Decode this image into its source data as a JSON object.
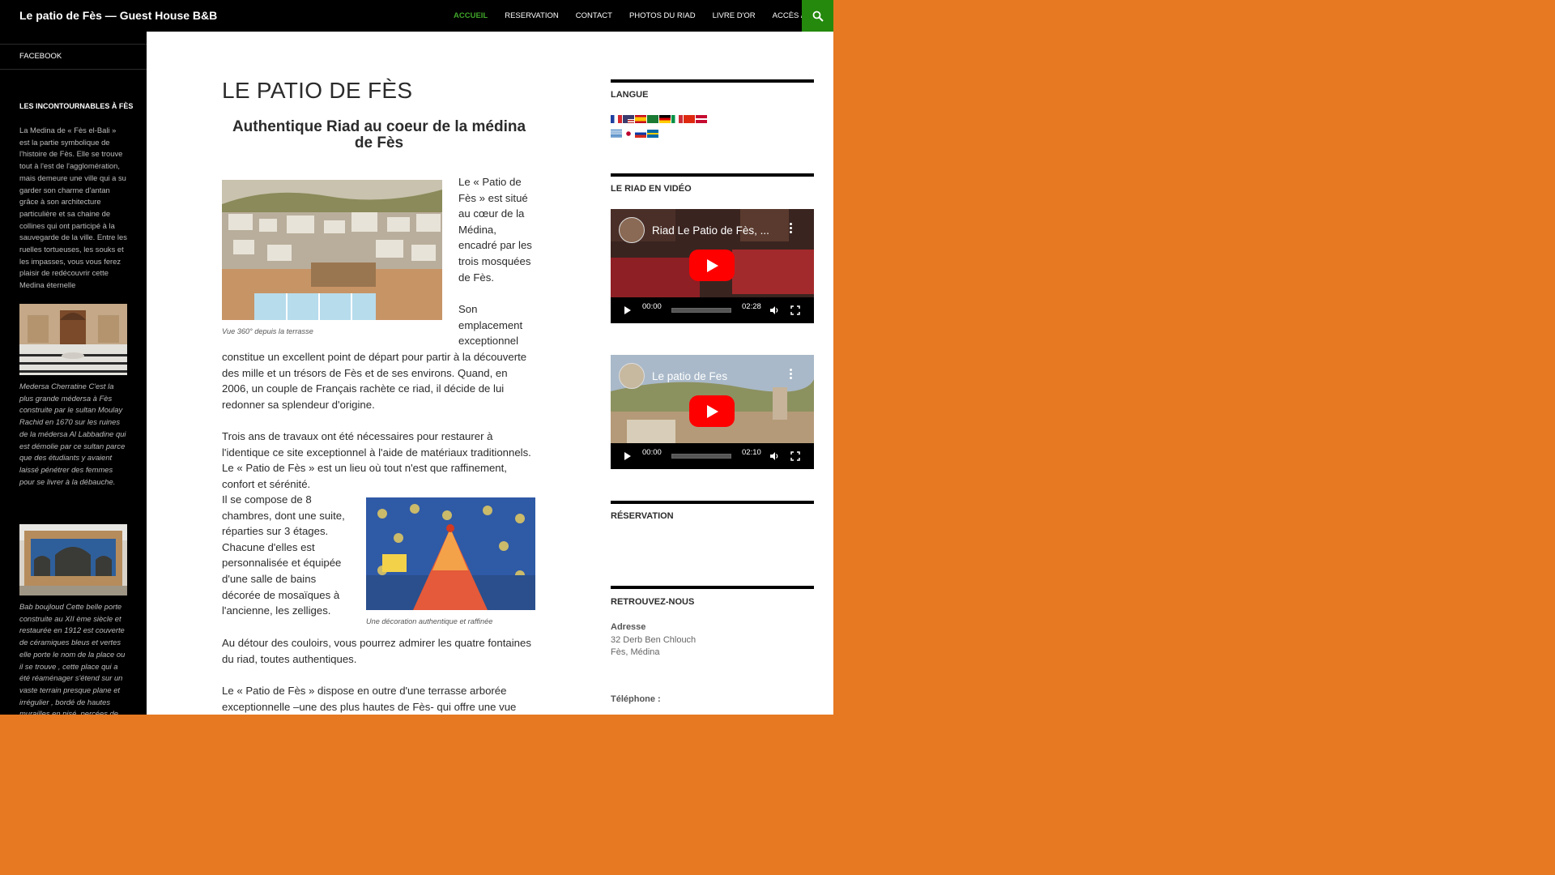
{
  "header": {
    "site_title": "Le patio de Fès — Guest House B&B",
    "nav": [
      {
        "label": "ACCUEIL",
        "active": true
      },
      {
        "label": "RESERVATION"
      },
      {
        "label": "CONTACT"
      },
      {
        "label": "PHOTOS DU RIAD"
      },
      {
        "label": "LIVRE D'OR"
      },
      {
        "label": "ACCÈS / PLAN"
      }
    ],
    "search_icon": "search-icon"
  },
  "left_sidebar": {
    "menu_item": "FACEBOOK",
    "widget_title": "LES INCONTOURNABLES À FÈS",
    "intro": "La Medina de « Fès el-Bali » est la partie symbolique de l'histoire de Fès. Elle se trouve tout à l'est de l'agglomération, mais demeure une ville qui a su garder son charme d'antan grâce à son architecture particulière et sa chaine de collines qui ont participé à la sauvegarde de la ville. Entre les ruelles tortueuses, les souks et les impasses, vous vous ferez plaisir de redécouvrir cette Medina éternelle",
    "caption1": "Medersa Cherratine C'est la plus grande médersa à Fès construite par le sultan Moulay Rachid en 1670 sur les ruines de la médersa Al Labbadine qui est démolie par ce sultan parce que des étudiants y avaient laissé pénétrer des femmes pour se livrer à la débauche.",
    "caption2": "Bab boujloud Cette belle porte construite au XII ème siècle et restaurée en 1912 est couverte de céramiques bleus et vertes elle porte le nom de la place ou il se trouve , cette place qui a été réaménager s'étend sur un vaste terrain presque plane et irrégulier , bordé de hautes murailles en pisé, percées de plusieurs portes"
  },
  "main": {
    "title": "LE PATIO DE FÈS",
    "subtitle": "Authentique Riad au coeur de la médina de Fès",
    "p1": "Le « Patio de Fès » est situé au cœur de la Médina, encadré par les trois mosquées de Fès.",
    "p2_start": "Son emplacement exceptionnel",
    "p2_rest": "constitue un excellent point de départ pour partir à la découverte des mille et un trésors de Fès et de ses environs. Quand, en 2006, un couple de Français rachète ce riad, il décide de lui redonner sa splendeur d'origine.",
    "p3": "Trois ans de travaux ont été nécessaires pour restaurer à l'identique ce site exceptionnel à l'aide de matériaux traditionnels. Le « Patio de Fès » est un lieu où tout n'est que raffinement, confort et sérénité.",
    "p4": "Il se compose de 8 chambres, dont une suite, réparties sur 3 étages. Chacune d'elles est personnalisée et équipée d'une salle de bains décorée de mosaïques à l'ancienne, les zelliges.",
    "p5": "Au détour des couloirs, vous pourrez admirer les quatre fontaines du riad, toutes authentiques.",
    "p6": "Le « Patio de Fès » dispose en outre d'une terrasse arborée exceptionnelle –une des plus hautes de Fès- qui offre une vue",
    "caption1": "Vue 360° depuis la terrasse",
    "caption2": "Une décoration authentique et raffinée"
  },
  "right_sidebar": {
    "langue_title": "LANGUE",
    "video_title": "LE RIAD EN VIDÉO",
    "videos": [
      {
        "title": "Riad Le Patio de Fès, ...",
        "start": "00:00",
        "duration": "02:28"
      },
      {
        "title": "Le patio de Fes",
        "start": "00:00",
        "duration": "02:10"
      }
    ],
    "reservation_title": "RÉSERVATION",
    "retrouvez_title": "RETROUVEZ-NOUS",
    "adresse_label": "Adresse",
    "adresse_line1": "32 Derb Ben Chlouch",
    "adresse_line2": "Fès, Médina",
    "telephone_label": "Téléphone :"
  },
  "colors": {
    "background": "#e67922",
    "accent_green": "#24890d",
    "active_nav": "#41a62a"
  }
}
